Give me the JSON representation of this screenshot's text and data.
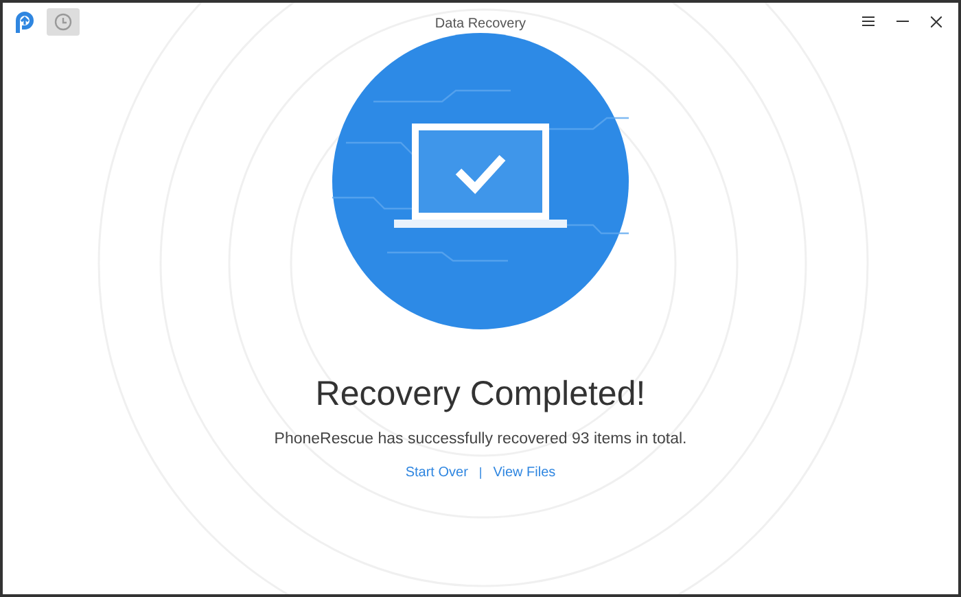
{
  "window": {
    "title": "Data Recovery"
  },
  "result": {
    "heading": "Recovery Completed!",
    "message": "PhoneRescue has successfully recovered 93 items in total."
  },
  "links": [
    {
      "label": "Start Over"
    },
    {
      "label": "View Files"
    }
  ],
  "separator": "|"
}
